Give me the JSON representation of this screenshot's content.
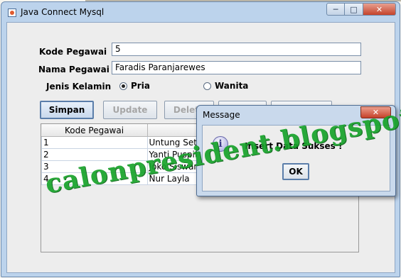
{
  "window": {
    "title": "Java Connect Mysql",
    "controls": {
      "minimize": "─",
      "maximize": "□",
      "close": "✕"
    }
  },
  "form": {
    "kode_label": "Kode Pegawai",
    "kode_value": "5",
    "nama_label": "Nama Pegawai",
    "nama_value": "Faradis Paranjarewes",
    "jenis_label": "Jenis Kelamin",
    "gender_options": [
      {
        "label": "Pria",
        "selected": true
      },
      {
        "label": "Wanita",
        "selected": false
      }
    ]
  },
  "buttons": {
    "simpan": "Simpan",
    "update": "Update",
    "delete": "Delete"
  },
  "table": {
    "columns": [
      "Kode Pegawai",
      "Nama Pegawai"
    ],
    "rows": [
      [
        "1",
        "Untung Setiawan"
      ],
      [
        "2",
        "Yanti Puspita"
      ],
      [
        "3",
        "Joko Siswanto"
      ],
      [
        "4",
        "Nur Layla"
      ]
    ]
  },
  "dialog": {
    "title": "Message",
    "close": "✕",
    "icon": "info-icon",
    "icon_glyph": "i",
    "message": "Insert Data Sukses !",
    "ok_label": "OK"
  },
  "watermark": {
    "text": "calonpresident.blogspot.com",
    "color": "#17a32a"
  }
}
